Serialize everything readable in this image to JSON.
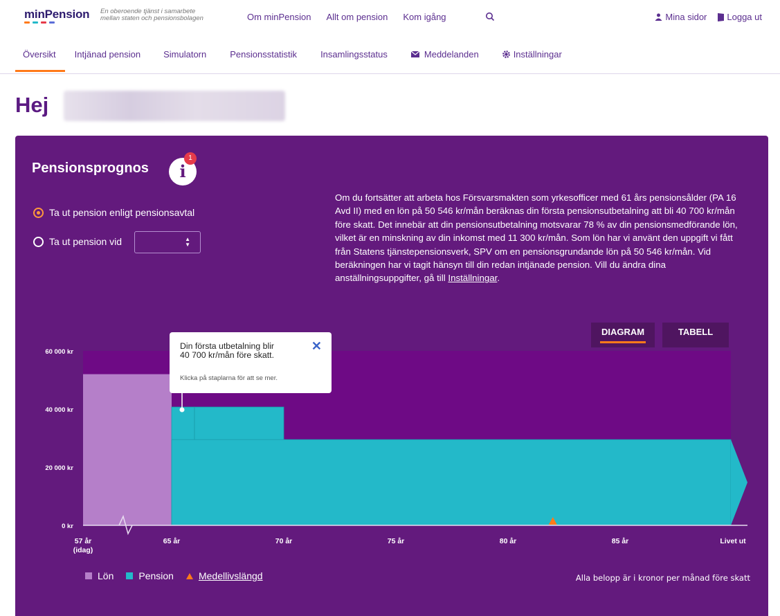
{
  "header": {
    "logo": "minPension",
    "tagline": [
      "En oberoende tjänst i samarbete",
      "mellan staten och pensionsbolagen"
    ],
    "nav": [
      "Om minPension",
      "Allt om pension",
      "Kom igång"
    ],
    "search_icon": "search-icon",
    "user_links": [
      "Mina sidor",
      "Logga ut"
    ]
  },
  "subnav": {
    "tabs": [
      "Översikt",
      "Intjänad pension",
      "Simulatorn",
      "Pensionsstatistik",
      "Insamlingsstatus",
      "Meddelanden",
      "Inställningar"
    ],
    "active": "Översikt"
  },
  "greeting": "Hej",
  "panel": {
    "title": "Pensionsprognos",
    "info_badge": "1",
    "radio_options": [
      "Ta ut pension enligt pensionsavtal",
      "Ta ut pension vid"
    ],
    "radio_selected": 0,
    "description": "Om du fortsätter att arbeta hos Försvarsmakten som yrkesofficer med 61 års pensionsålder (PA 16 Avd II) med en lön på 50 546 kr/mån beräknas din första pensionsutbetalning att bli 40 700 kr/mån före skatt. Det innebär att din pensionsutbetalning motsvarar 78 % av din pensionsmedförande lön, vilket är en minskning av din inkomst med 11 300 kr/mån. Som lön har vi använt den uppgift vi fått från Statens tjänstepensionsverk, SPV om en pensionsgrundande lön på 50 546 kr/mån. Vid beräkningen har vi tagit hänsyn till din redan intjänade pension. Vill du ändra dina anställningsuppgifter, gå till",
    "description_link": "Inställningar",
    "description_end": ".",
    "view_toggle": [
      "DIAGRAM",
      "TABELL"
    ],
    "active_view": "DIAGRAM"
  },
  "tooltip": {
    "line1": "Din första utbetalning blir",
    "line2": "40 700 kr/mån före skatt.",
    "hint": "Klicka på staplarna för att se mer."
  },
  "legend": [
    "Lön",
    "Pension",
    "Medellivslängd"
  ],
  "footnote": "Alla belopp är i kronor per månad före skatt",
  "colors": {
    "panel": "#631a7d",
    "salary": "#b57fc9",
    "pension": "#23b9c9",
    "life_expectancy": "#ff7a1a",
    "accent": "#ff7a1a"
  },
  "chart_data": {
    "type": "area",
    "y_ticks": [
      "60 000 kr",
      "40 000 kr",
      "20 000 kr",
      "0 kr"
    ],
    "ylim": [
      0,
      60000
    ],
    "x_ticks": [
      "57 år\n(idag)",
      "65 år",
      "70 år",
      "75 år",
      "80 år",
      "85 år",
      "Livet ut"
    ],
    "series": [
      {
        "name": "Lön",
        "segments": [
          {
            "from": "57 år",
            "to": "61 år",
            "value": 52000
          }
        ]
      },
      {
        "name": "Pension",
        "segments": [
          {
            "from": "61 år",
            "to": "62 år",
            "value": 40700
          },
          {
            "from": "62 år",
            "to": "65 år",
            "value": 40700
          },
          {
            "from": "65 år",
            "to": "Livet ut",
            "value": 29500
          }
        ]
      }
    ],
    "markers": [
      {
        "name": "Medellivslängd",
        "x": "82 år"
      }
    ]
  }
}
